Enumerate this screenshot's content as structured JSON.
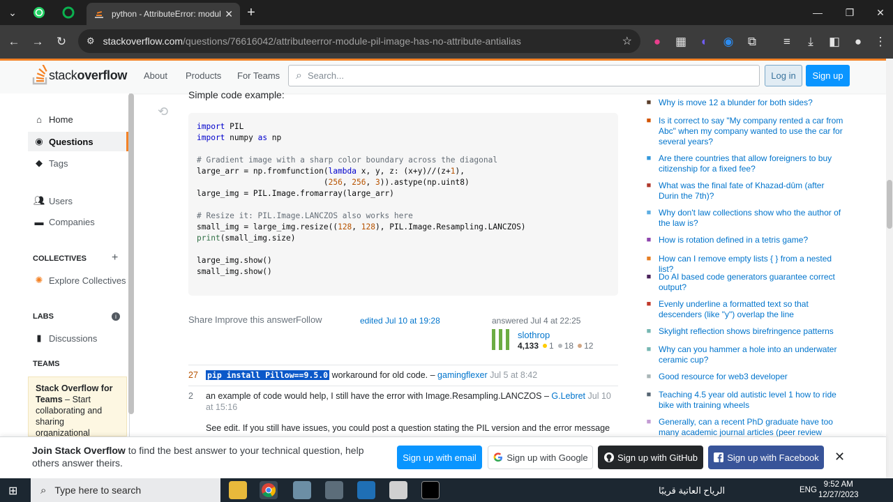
{
  "browser": {
    "tab_title": "python - AttributeError: module",
    "url_host": "stackoverflow.com",
    "url_path": "/questions/76616042/attributeerror-module-pil-image-has-no-attribute-antialias"
  },
  "header": {
    "logo_text_light": "stack",
    "logo_text_bold": "overflow",
    "nav": [
      "About",
      "Products",
      "For Teams"
    ],
    "search_placeholder": "Search...",
    "login": "Log in",
    "signup": "Sign up"
  },
  "sidebar": {
    "home": "Home",
    "questions": "Questions",
    "tags": "Tags",
    "users": "Users",
    "companies": "Companies",
    "collectives_head": "COLLECTIVES",
    "explore_collectives": "Explore Collectives",
    "labs_head": "LABS",
    "discussions": "Discussions",
    "teams_head": "TEAMS",
    "teams_title": "Stack Overflow for Teams",
    "teams_desc": " – Start collaborating and sharing organizational knowledge."
  },
  "answer": {
    "intro": "Simple code example:",
    "code": [
      "import PIL",
      "import numpy as np",
      "",
      "# Gradient image with a sharp color boundary across the diagonal",
      "large_arr = np.fromfunction(lambda x, y, z: (x+y)//(z+1),",
      "                           (256, 256, 3)).astype(np.uint8)",
      "large_img = PIL.Image.fromarray(large_arr)",
      "",
      "# Resize it: PIL.Image.LANCZOS also works here",
      "small_img = large_img.resize((128, 128), PIL.Image.Resampling.LANCZOS)",
      "print(small_img.size)",
      "",
      "large_img.show()",
      "small_img.show()"
    ],
    "share": "Share",
    "improve": "Improve this answer",
    "follow": "Follow",
    "edited": "edited Jul 10 at 19:28",
    "answered": "answered Jul 4 at 22:25",
    "user_name": "slothrop",
    "user_rep": "4,133",
    "gold": "1",
    "silver": "18",
    "bronze": "12"
  },
  "comments": [
    {
      "score": "27",
      "code": "pip install Pillow==9.5.0",
      "text": " workaround for old code. – ",
      "user": "gamingflexer",
      "date": " Jul 5 at 8:42"
    },
    {
      "score": "2",
      "text": "an example of code would help, I still have the error with Image.Resampling.LANCZOS – ",
      "user": "G.Lebret",
      "date": " Jul 10 at 15:16"
    },
    {
      "score": "",
      "text": "See edit. If you still have issues, you could post a question stating the PIL version and the error message you"
    }
  ],
  "hot_questions": [
    {
      "title": "Why is move 12 a blunder for both sides?",
      "icon": "chess-icon",
      "color": "#5a3e2b"
    },
    {
      "title": "Is it correct to say \"My company rented a car from Abc\" when my company wanted to use the car for several years?",
      "icon": "bookmark-icon",
      "color": "#d35400"
    },
    {
      "title": "Are there countries that allow foreigners to buy citizenship for a fixed fee?",
      "icon": "passport-icon",
      "color": "#3498db"
    },
    {
      "title": "What was the final fate of Khazad-dûm (after Durin the 7th)?",
      "icon": "ring-icon",
      "color": "#b03a2e"
    },
    {
      "title": "Why don't law collections show who the author of the law is?",
      "icon": "law-icon",
      "color": "#5dade2"
    },
    {
      "title": "How is rotation defined in a tetris game?",
      "icon": "puzzle-icon",
      "color": "#8e44ad"
    },
    {
      "title": "How can I remove empty lists { } from a nested list?",
      "icon": "mathematica-icon",
      "color": "#e67e22"
    },
    {
      "title": "Do AI based code generators guarantee correct output?",
      "icon": "ai-icon",
      "color": "#4a235a"
    },
    {
      "title": "Evenly underline a formatted text so that descenders (like \"y\") overlap the line",
      "icon": "tex-icon",
      "color": "#c0392b"
    },
    {
      "title": "Skylight reflection shows birefringence patterns",
      "icon": "physics-icon",
      "color": "#76b7b2"
    },
    {
      "title": "Why can you hammer a hole into an underwater ceramic cup?",
      "icon": "physics-icon",
      "color": "#76b7b2"
    },
    {
      "title": "Good resource for web3 developer",
      "icon": "ethereum-icon",
      "color": "#aab7b8"
    },
    {
      "title": "Teaching 4.5 year old autistic level 1 how to ride bike with training wheels",
      "icon": "parenting-icon",
      "color": "#566573"
    },
    {
      "title": "Generally, can a recent PhD graduate have too many academic journal articles (peer review",
      "icon": "academia-icon",
      "color": "#c39bd3"
    }
  ],
  "banner": {
    "title": "Join Stack Overflow",
    "text": " to find the best answer to your technical question, help others answer theirs.",
    "email": "Sign up with email",
    "google": "Sign up with Google",
    "github": "Sign up with GitHub",
    "facebook": "Sign up with Facebook"
  },
  "taskbar": {
    "search": "Type here to search",
    "weather": "الرياح العاتية قريبًا",
    "lang": "ENG",
    "time": "9:52 AM",
    "date": "12/27/2023"
  }
}
